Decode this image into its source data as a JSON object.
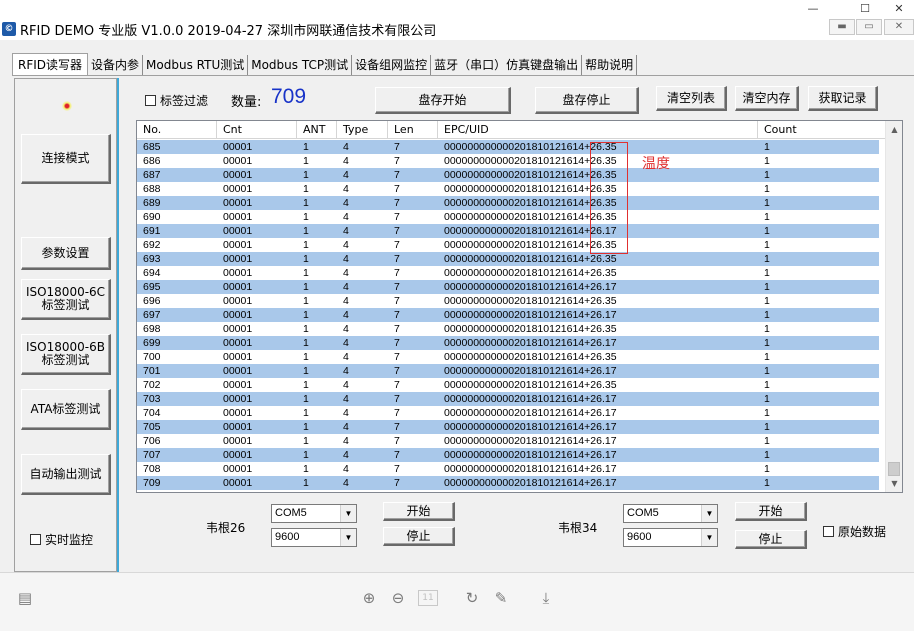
{
  "window": {
    "title": "RFID DEMO 专业版 V1.0.0  2019-04-27 深圳市网联通信技术有限公司",
    "minimize_glyph": "—",
    "maximize_glyph": "☐",
    "close_glyph": "✕"
  },
  "tabs": [
    {
      "label": "RFID读写器"
    },
    {
      "label": "设备内参"
    },
    {
      "label": "Modbus RTU测试"
    },
    {
      "label": "Modbus TCP测试"
    },
    {
      "label": "设备组网监控"
    },
    {
      "label": "蓝牙（串口）仿真键盘输出"
    },
    {
      "label": "帮助说明"
    }
  ],
  "sidebar": {
    "connect_mode": "连接模式",
    "param_settings": "参数设置",
    "iso6c": "ISO18000-6C\n标签测试",
    "iso6b": "ISO18000-6B\n标签测试",
    "ata": "ATA标签测试",
    "auto_output": "自动输出测试",
    "realtime_monitor": "实时监控"
  },
  "toolbar": {
    "tag_filter": "标签过滤",
    "count_label": "数量:",
    "count_value": "709",
    "inventory_start": "盘存开始",
    "inventory_stop": "盘存停止",
    "clear_list": "清空列表",
    "clear_memory": "清空内存",
    "get_records": "获取记录"
  },
  "table": {
    "columns": [
      "No.",
      "Cnt",
      "ANT",
      "Type",
      "Len",
      "EPC/UID",
      "Count"
    ],
    "rows": [
      [
        "685",
        "00001",
        "1",
        "4",
        "7",
        "000000000000201810121614+26.35",
        "1"
      ],
      [
        "686",
        "00001",
        "1",
        "4",
        "7",
        "000000000000201810121614+26.35",
        "1"
      ],
      [
        "687",
        "00001",
        "1",
        "4",
        "7",
        "000000000000201810121614+26.35",
        "1"
      ],
      [
        "688",
        "00001",
        "1",
        "4",
        "7",
        "000000000000201810121614+26.35",
        "1"
      ],
      [
        "689",
        "00001",
        "1",
        "4",
        "7",
        "000000000000201810121614+26.35",
        "1"
      ],
      [
        "690",
        "00001",
        "1",
        "4",
        "7",
        "000000000000201810121614+26.35",
        "1"
      ],
      [
        "691",
        "00001",
        "1",
        "4",
        "7",
        "000000000000201810121614+26.17",
        "1"
      ],
      [
        "692",
        "00001",
        "1",
        "4",
        "7",
        "000000000000201810121614+26.35",
        "1"
      ],
      [
        "693",
        "00001",
        "1",
        "4",
        "7",
        "000000000000201810121614+26.35",
        "1"
      ],
      [
        "694",
        "00001",
        "1",
        "4",
        "7",
        "000000000000201810121614+26.35",
        "1"
      ],
      [
        "695",
        "00001",
        "1",
        "4",
        "7",
        "000000000000201810121614+26.17",
        "1"
      ],
      [
        "696",
        "00001",
        "1",
        "4",
        "7",
        "000000000000201810121614+26.35",
        "1"
      ],
      [
        "697",
        "00001",
        "1",
        "4",
        "7",
        "000000000000201810121614+26.17",
        "1"
      ],
      [
        "698",
        "00001",
        "1",
        "4",
        "7",
        "000000000000201810121614+26.35",
        "1"
      ],
      [
        "699",
        "00001",
        "1",
        "4",
        "7",
        "000000000000201810121614+26.17",
        "1"
      ],
      [
        "700",
        "00001",
        "1",
        "4",
        "7",
        "000000000000201810121614+26.35",
        "1"
      ],
      [
        "701",
        "00001",
        "1",
        "4",
        "7",
        "000000000000201810121614+26.17",
        "1"
      ],
      [
        "702",
        "00001",
        "1",
        "4",
        "7",
        "000000000000201810121614+26.35",
        "1"
      ],
      [
        "703",
        "00001",
        "1",
        "4",
        "7",
        "000000000000201810121614+26.17",
        "1"
      ],
      [
        "704",
        "00001",
        "1",
        "4",
        "7",
        "000000000000201810121614+26.17",
        "1"
      ],
      [
        "705",
        "00001",
        "1",
        "4",
        "7",
        "000000000000201810121614+26.17",
        "1"
      ],
      [
        "706",
        "00001",
        "1",
        "4",
        "7",
        "000000000000201810121614+26.17",
        "1"
      ],
      [
        "707",
        "00001",
        "1",
        "4",
        "7",
        "000000000000201810121614+26.17",
        "1"
      ],
      [
        "708",
        "00001",
        "1",
        "4",
        "7",
        "000000000000201810121614+26.17",
        "1"
      ],
      [
        "709",
        "00001",
        "1",
        "4",
        "7",
        "000000000000201810121614+26.17",
        "1"
      ]
    ]
  },
  "annotation": {
    "temperature_note": "温度",
    "color": "#e03030"
  },
  "wiegand26": {
    "label": "韦根26",
    "port": "COM5",
    "baud": "9600",
    "start": "开始",
    "stop": "停止"
  },
  "wiegand34": {
    "label": "韦根34",
    "port": "COM5",
    "baud": "9600",
    "start": "开始",
    "stop": "停止"
  },
  "raw_data": "原始数据",
  "statusbar": {
    "page_indicator": "11"
  },
  "colors": {
    "accent": "#1833c8",
    "row_highlight": "#a9c8ea"
  }
}
